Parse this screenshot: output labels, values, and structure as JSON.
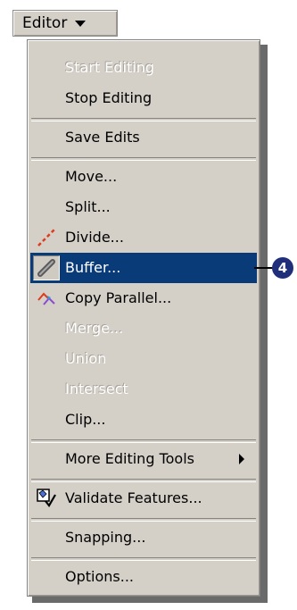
{
  "toolbar": {
    "editor_label": "Editor"
  },
  "menu": {
    "start_editing": "Start Editing",
    "stop_editing": "Stop Editing",
    "save_edits": "Save Edits",
    "move": "Move...",
    "split": "Split...",
    "divide": "Divide...",
    "buffer": "Buffer...",
    "copy_parallel": "Copy Parallel...",
    "merge": "Merge...",
    "union": "Union",
    "intersect": "Intersect",
    "clip": "Clip...",
    "more_editing_tools": "More Editing Tools",
    "validate_features": "Validate Features...",
    "snapping": "Snapping...",
    "options": "Options..."
  },
  "icons": {
    "divide": "divide-line-icon",
    "buffer": "pencil-buffer-icon",
    "copy_parallel": "copy-parallel-icon",
    "validate_features": "validate-checkmark-icon"
  },
  "callout": {
    "number": "4"
  },
  "colors": {
    "menu_background": "#d4d0c8",
    "highlight": "#0a3b79",
    "callout": "#1f2f7a",
    "divide_icon": "#e03a1c"
  }
}
